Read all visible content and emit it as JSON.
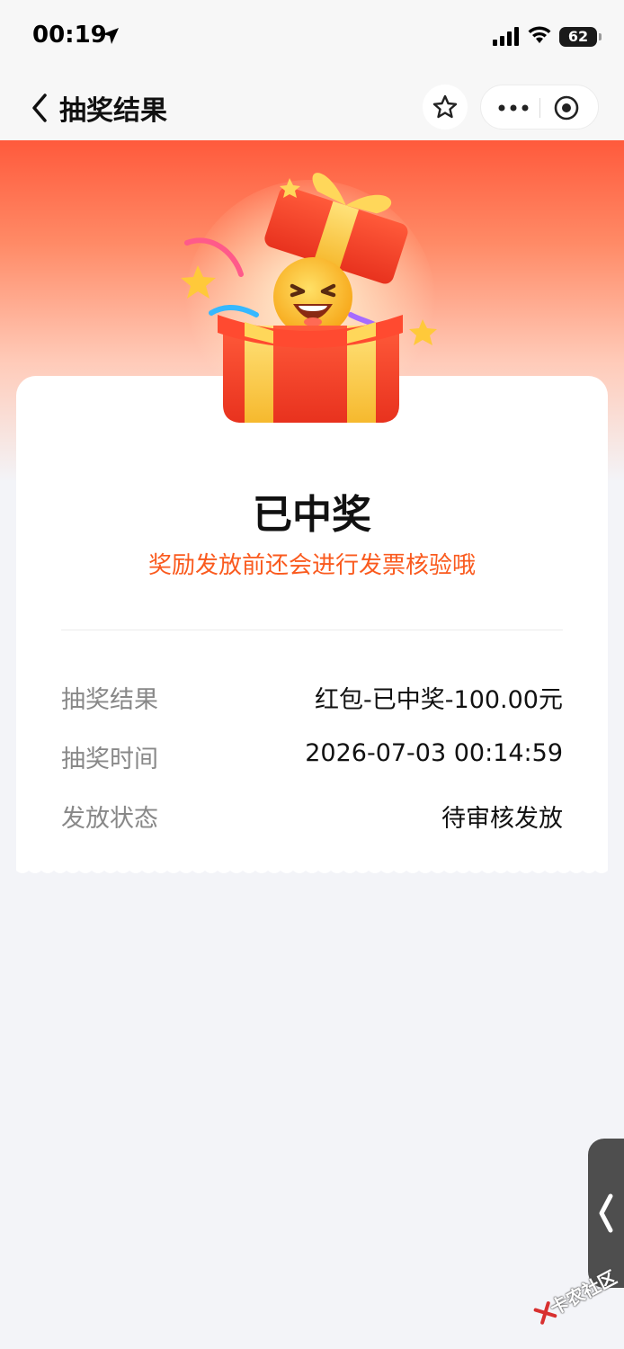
{
  "status_bar": {
    "time": "00:19",
    "battery": "62"
  },
  "nav": {
    "title": "抽奖结果"
  },
  "result": {
    "title": "已中奖",
    "subtitle": "奖励发放前还会进行发票核验哦",
    "rows": [
      {
        "label": "抽奖结果",
        "value": "红包-已中奖-100.00元"
      },
      {
        "label": "抽奖时间",
        "value": "2026-07-03 00:14:59"
      },
      {
        "label": "发放状态",
        "value": "待审核发放"
      }
    ]
  },
  "watermark": {
    "text": "卡农社区"
  },
  "colors": {
    "accent": "#fa5a1e",
    "hero_top": "#ff5a3c",
    "background": "#f3f4f8"
  }
}
